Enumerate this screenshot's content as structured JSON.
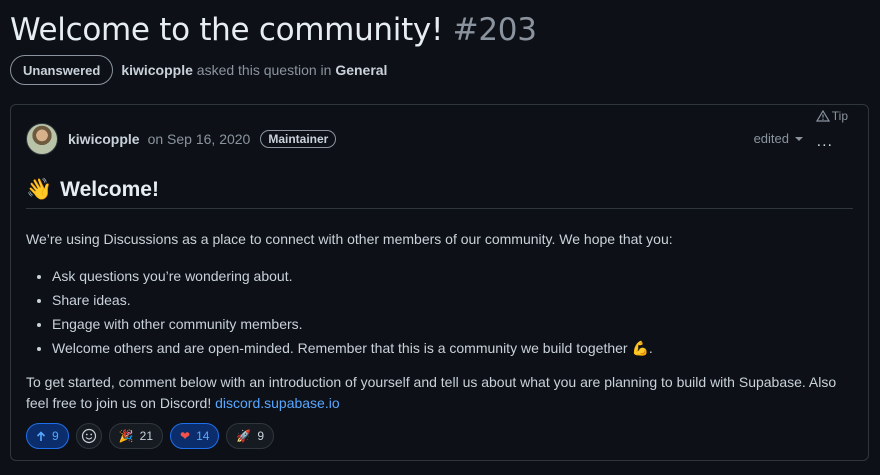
{
  "page": {
    "title": "Welcome to the community!",
    "number": "#203",
    "status": "Unanswered",
    "author": "kiwicopple",
    "asked_text": "asked this question in",
    "category": "General"
  },
  "post": {
    "tip_label": "Tip",
    "author": "kiwicopple",
    "date": "on Sep 16, 2020",
    "badge": "Maintainer",
    "edited_label": "edited",
    "more_label": "...",
    "heading_emoji": "👋",
    "heading": "Welcome!",
    "intro": "We’re using Discussions as a place to connect with other members of our community. We hope that you:",
    "bullets": [
      "Ask questions you’re wondering about.",
      "Share ideas.",
      "Engage with other community members.",
      "Welcome others and are open-minded. Remember that this is a community we build together 💪."
    ],
    "closing": "To get started, comment below with an introduction of yourself and tell us about what you are planning to build with Supabase. Also feel free to join us on Discord!",
    "link": "discord.supabase.io"
  },
  "reactions": {
    "upvote": "9",
    "tada": "21",
    "heart": "14",
    "rocket": "9"
  },
  "colors": {
    "accent": "#58a6ff",
    "background": "#0d1117",
    "border": "#30363d"
  },
  "icons": [
    "arrow-up-icon",
    "smiley-icon",
    "tada-icon",
    "heart-icon",
    "rocket-icon",
    "alert-triangle-icon",
    "kebab-icon"
  ]
}
